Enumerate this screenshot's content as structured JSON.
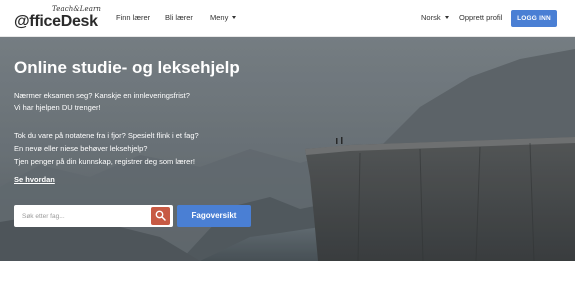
{
  "nav": {
    "logo": {
      "tagline": "Teach&Learn",
      "name": "@fficeDesk"
    },
    "links": {
      "finn_laerer": "Finn lærer",
      "bli_laerer": "Bli lærer",
      "meny": "Meny"
    },
    "language": "Norsk",
    "create_profile": "Opprett profil",
    "login": "LOGG INN"
  },
  "hero": {
    "title": "Online studie- og leksehjelp",
    "lines": [
      "Nærmer eksamen seg? Kanskje en innleveringsfrist?",
      "Vi har hjelpen DU trenger!",
      "Tok du vare på notatene fra i fjor? Spesielt flink i et fag?",
      "En nevø eller niese behøver leksehjelp?",
      "Tjen penger på din kunnskap, registrer deg som lærer!"
    ],
    "link": "Se hvordan",
    "search": {
      "placeholder": "Søk etter fag..."
    },
    "subjects_button": "Fagoversikt"
  },
  "colors": {
    "primary_blue": "#4a7fd4",
    "search_red": "#c75a44"
  },
  "icons": [
    "chevron-down-icon",
    "search-icon"
  ]
}
